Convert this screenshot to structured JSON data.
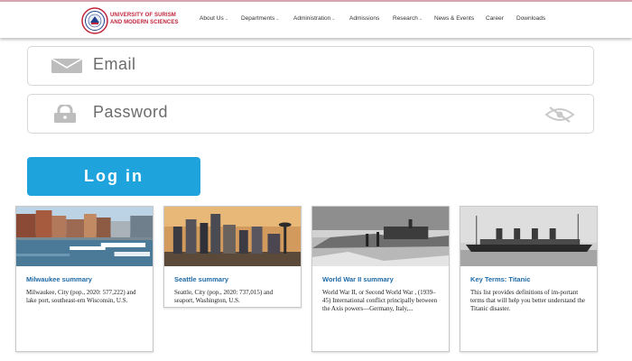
{
  "header": {
    "brand_line1": "UNIVERSITY OF SURISM",
    "brand_line2": "AND MODERN SCIENCES",
    "nav": [
      {
        "label": "About Us",
        "dropdown": true
      },
      {
        "label": "Departments",
        "dropdown": true
      },
      {
        "label": "Administration",
        "dropdown": true
      },
      {
        "label": "Admissions",
        "dropdown": false
      },
      {
        "label": "Research",
        "dropdown": true
      },
      {
        "label": "News & Events",
        "dropdown": false
      },
      {
        "label": "Career",
        "dropdown": false
      },
      {
        "label": "Downloads",
        "dropdown": false
      }
    ],
    "caret": "⌄"
  },
  "login": {
    "email_placeholder": "Email",
    "password_placeholder": "Password",
    "submit_label": "Log in"
  },
  "cards": [
    {
      "title": "Milwaukee summary",
      "description": "Milwaukee, City (pop., 2020: 577,222) and lake port, southeast-ern Wisconsin, U.S."
    },
    {
      "title": "Seattle summary",
      "description": "Seattle, City (pop., 2020: 737,015) and seaport, Washington, U.S."
    },
    {
      "title": "World War II summary",
      "description": "World War II, or Second World War , (1939–45) International conflict principally between the Axis powers—Germany, Italy,..."
    },
    {
      "title": "Key Terms: Titanic",
      "description": "This list provides definitions of im-portant terms that will help you better understand the Titanic disaster."
    }
  ],
  "colors": {
    "brand_red": "#c0233a",
    "button_blue": "#1ea3dd",
    "card_title_blue": "#1f6aa6"
  },
  "icons": [
    "logo-seal",
    "envelope-icon",
    "lock-icon",
    "eye-off-icon"
  ]
}
